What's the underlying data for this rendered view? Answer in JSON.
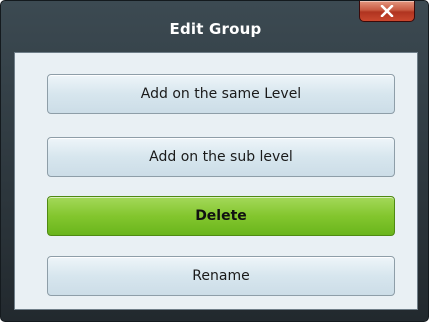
{
  "window": {
    "title": "Edit Group",
    "close_icon": "close-x-icon"
  },
  "buttons": {
    "add_same_level": "Add on the same Level",
    "add_sub_level": "Add on the sub level",
    "delete": "Delete",
    "rename": "Rename"
  },
  "colors": {
    "title_bar": "#2c363c",
    "content_background": "#e9f0f4",
    "button_default": "#d7e6ee",
    "button_delete": "#83c62e",
    "close_button": "#c24a33"
  }
}
